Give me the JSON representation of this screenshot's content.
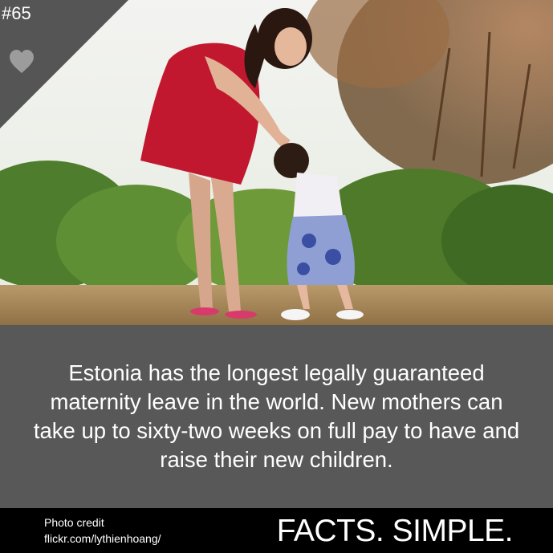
{
  "badge": {
    "number": "#65",
    "icon": "heart-icon"
  },
  "photo": {
    "description_icon": "photo"
  },
  "fact": {
    "text": "Estonia has the longest legally guaranteed maternity leave in the world. New mothers can take up to sixty-two weeks on full pay to have and raise their new children."
  },
  "footer": {
    "credit_label": "Photo credit",
    "credit_source": "flickr.com/lythienhoang/",
    "brand": "FACTS. SIMPLE."
  },
  "colors": {
    "panel": "#585858",
    "footer": "#000000",
    "text": "#ffffff",
    "badge": "#555555"
  }
}
